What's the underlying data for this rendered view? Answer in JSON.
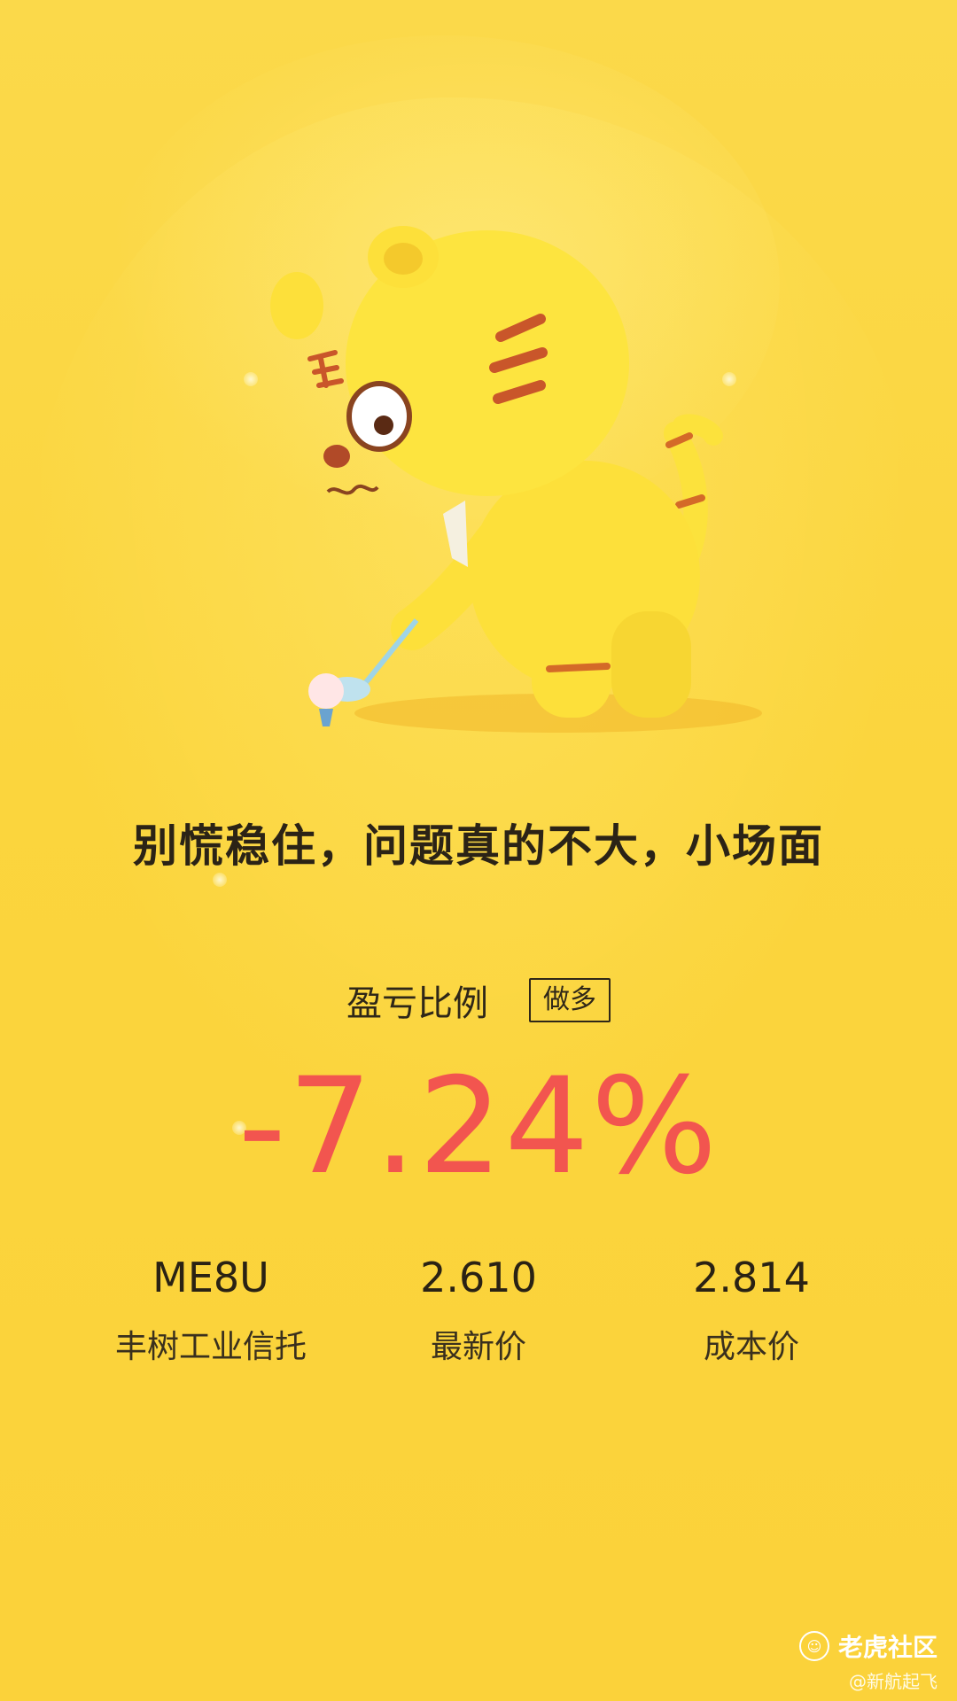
{
  "headline": "别慌稳住，问题真的不大，小场面",
  "profit_loss": {
    "label": "盈亏比例",
    "direction_badge": "做多",
    "value": "-7.24%",
    "value_color": "#f2554f"
  },
  "stats": [
    {
      "value": "ME8U",
      "label": "丰树工业信托"
    },
    {
      "value": "2.610",
      "label": "最新价"
    },
    {
      "value": "2.814",
      "label": "成本价"
    }
  ],
  "brand": {
    "name": "老虎社区",
    "icon": "tiger-logo-icon"
  },
  "watermark": "@新航起飞",
  "colors": {
    "background": "#fbd53d",
    "accent": "#f2554f",
    "text": "#2b2316"
  }
}
